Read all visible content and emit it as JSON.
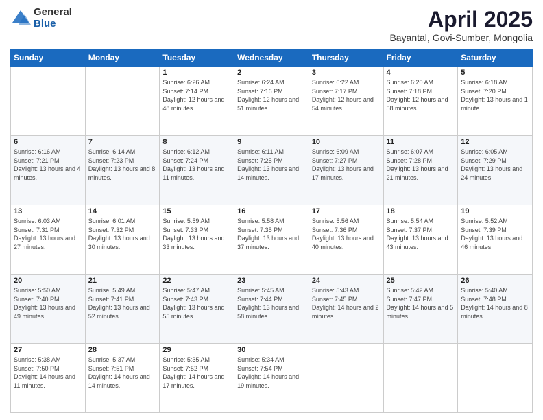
{
  "logo": {
    "general": "General",
    "blue": "Blue"
  },
  "header": {
    "title": "April 2025",
    "subtitle": "Bayantal, Govi-Sumber, Mongolia"
  },
  "days_of_week": [
    "Sunday",
    "Monday",
    "Tuesday",
    "Wednesday",
    "Thursday",
    "Friday",
    "Saturday"
  ],
  "weeks": [
    [
      {
        "day": "",
        "info": ""
      },
      {
        "day": "",
        "info": ""
      },
      {
        "day": "1",
        "info": "Sunrise: 6:26 AM\nSunset: 7:14 PM\nDaylight: 12 hours and 48 minutes."
      },
      {
        "day": "2",
        "info": "Sunrise: 6:24 AM\nSunset: 7:16 PM\nDaylight: 12 hours and 51 minutes."
      },
      {
        "day": "3",
        "info": "Sunrise: 6:22 AM\nSunset: 7:17 PM\nDaylight: 12 hours and 54 minutes."
      },
      {
        "day": "4",
        "info": "Sunrise: 6:20 AM\nSunset: 7:18 PM\nDaylight: 12 hours and 58 minutes."
      },
      {
        "day": "5",
        "info": "Sunrise: 6:18 AM\nSunset: 7:20 PM\nDaylight: 13 hours and 1 minute."
      }
    ],
    [
      {
        "day": "6",
        "info": "Sunrise: 6:16 AM\nSunset: 7:21 PM\nDaylight: 13 hours and 4 minutes."
      },
      {
        "day": "7",
        "info": "Sunrise: 6:14 AM\nSunset: 7:23 PM\nDaylight: 13 hours and 8 minutes."
      },
      {
        "day": "8",
        "info": "Sunrise: 6:12 AM\nSunset: 7:24 PM\nDaylight: 13 hours and 11 minutes."
      },
      {
        "day": "9",
        "info": "Sunrise: 6:11 AM\nSunset: 7:25 PM\nDaylight: 13 hours and 14 minutes."
      },
      {
        "day": "10",
        "info": "Sunrise: 6:09 AM\nSunset: 7:27 PM\nDaylight: 13 hours and 17 minutes."
      },
      {
        "day": "11",
        "info": "Sunrise: 6:07 AM\nSunset: 7:28 PM\nDaylight: 13 hours and 21 minutes."
      },
      {
        "day": "12",
        "info": "Sunrise: 6:05 AM\nSunset: 7:29 PM\nDaylight: 13 hours and 24 minutes."
      }
    ],
    [
      {
        "day": "13",
        "info": "Sunrise: 6:03 AM\nSunset: 7:31 PM\nDaylight: 13 hours and 27 minutes."
      },
      {
        "day": "14",
        "info": "Sunrise: 6:01 AM\nSunset: 7:32 PM\nDaylight: 13 hours and 30 minutes."
      },
      {
        "day": "15",
        "info": "Sunrise: 5:59 AM\nSunset: 7:33 PM\nDaylight: 13 hours and 33 minutes."
      },
      {
        "day": "16",
        "info": "Sunrise: 5:58 AM\nSunset: 7:35 PM\nDaylight: 13 hours and 37 minutes."
      },
      {
        "day": "17",
        "info": "Sunrise: 5:56 AM\nSunset: 7:36 PM\nDaylight: 13 hours and 40 minutes."
      },
      {
        "day": "18",
        "info": "Sunrise: 5:54 AM\nSunset: 7:37 PM\nDaylight: 13 hours and 43 minutes."
      },
      {
        "day": "19",
        "info": "Sunrise: 5:52 AM\nSunset: 7:39 PM\nDaylight: 13 hours and 46 minutes."
      }
    ],
    [
      {
        "day": "20",
        "info": "Sunrise: 5:50 AM\nSunset: 7:40 PM\nDaylight: 13 hours and 49 minutes."
      },
      {
        "day": "21",
        "info": "Sunrise: 5:49 AM\nSunset: 7:41 PM\nDaylight: 13 hours and 52 minutes."
      },
      {
        "day": "22",
        "info": "Sunrise: 5:47 AM\nSunset: 7:43 PM\nDaylight: 13 hours and 55 minutes."
      },
      {
        "day": "23",
        "info": "Sunrise: 5:45 AM\nSunset: 7:44 PM\nDaylight: 13 hours and 58 minutes."
      },
      {
        "day": "24",
        "info": "Sunrise: 5:43 AM\nSunset: 7:45 PM\nDaylight: 14 hours and 2 minutes."
      },
      {
        "day": "25",
        "info": "Sunrise: 5:42 AM\nSunset: 7:47 PM\nDaylight: 14 hours and 5 minutes."
      },
      {
        "day": "26",
        "info": "Sunrise: 5:40 AM\nSunset: 7:48 PM\nDaylight: 14 hours and 8 minutes."
      }
    ],
    [
      {
        "day": "27",
        "info": "Sunrise: 5:38 AM\nSunset: 7:50 PM\nDaylight: 14 hours and 11 minutes."
      },
      {
        "day": "28",
        "info": "Sunrise: 5:37 AM\nSunset: 7:51 PM\nDaylight: 14 hours and 14 minutes."
      },
      {
        "day": "29",
        "info": "Sunrise: 5:35 AM\nSunset: 7:52 PM\nDaylight: 14 hours and 17 minutes."
      },
      {
        "day": "30",
        "info": "Sunrise: 5:34 AM\nSunset: 7:54 PM\nDaylight: 14 hours and 19 minutes."
      },
      {
        "day": "",
        "info": ""
      },
      {
        "day": "",
        "info": ""
      },
      {
        "day": "",
        "info": ""
      }
    ]
  ]
}
